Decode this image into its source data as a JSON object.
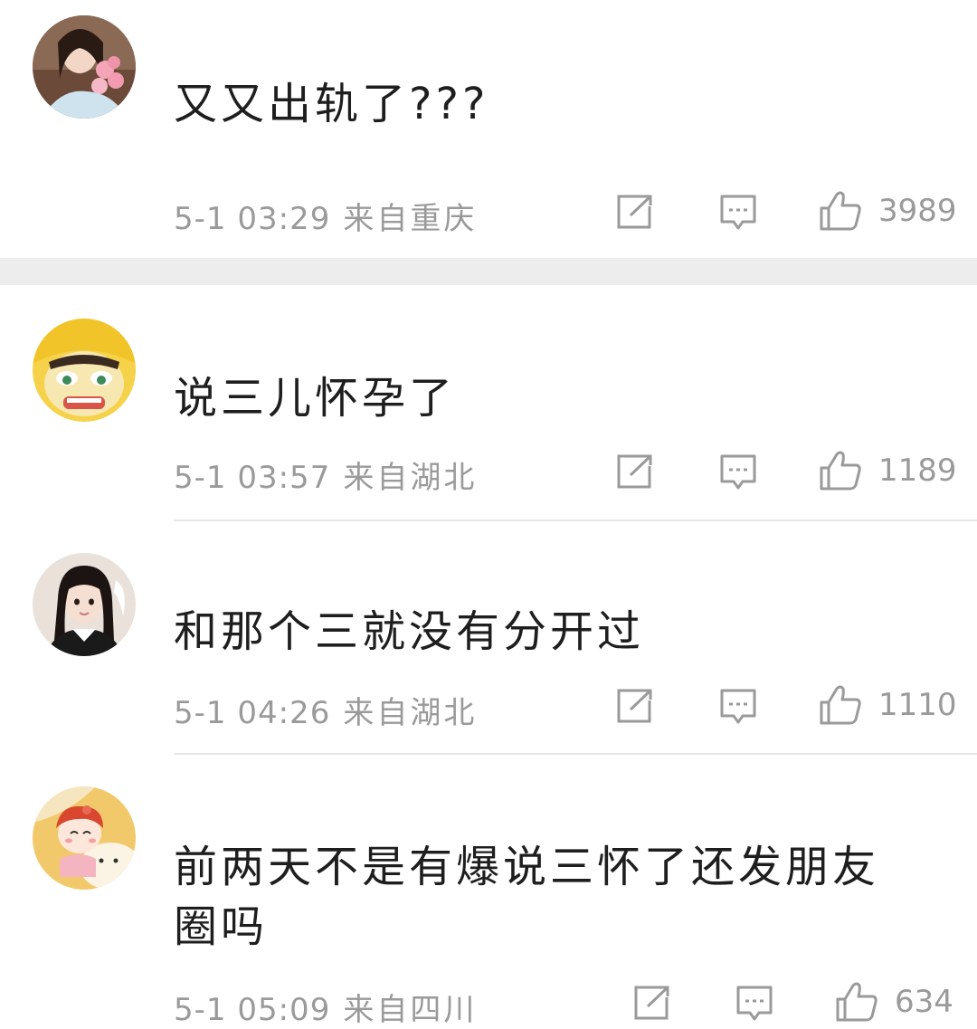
{
  "comments": [
    {
      "text": "又又出轨了???",
      "date": "5-1 03:29",
      "location": "来自重庆",
      "likes": "3989",
      "avatar": "girl-with-flowers"
    },
    {
      "text": "说三儿怀孕了",
      "date": "5-1 03:57",
      "location": "来自湖北",
      "likes": "1189",
      "avatar": "yellow-cartoon-face"
    },
    {
      "text": "和那个三就没有分开过",
      "date": "5-1 04:26",
      "location": "来自湖北",
      "likes": "1110",
      "avatar": "girl-portrait"
    },
    {
      "text": "前两天不是有爆说三怀了还发朋友圈吗",
      "date": "5-1 05:09",
      "location": "来自四川",
      "likes": "634",
      "avatar": "cartoon-girl-with-cat"
    }
  ],
  "icons": {
    "share": "share-icon",
    "comment": "comment-icon",
    "like": "like-icon"
  },
  "colors": {
    "meta": "#9a9a9a",
    "divider": "#ededed"
  }
}
